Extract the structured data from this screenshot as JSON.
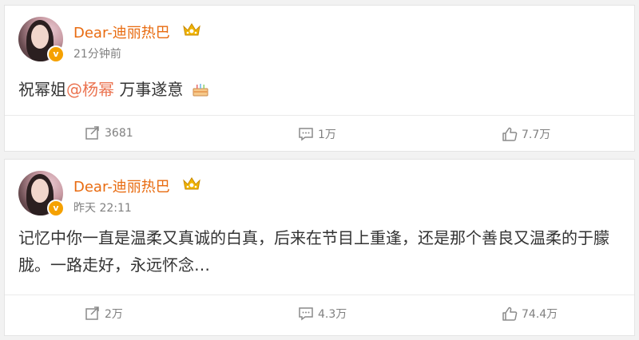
{
  "posts": [
    {
      "user": "Dear-迪丽热巴",
      "time": "21分钟前",
      "text_prefix": "祝幂姐",
      "mention": "@杨幂",
      "text_suffix": " 万事遂意",
      "emoji": "cake-icon",
      "repost_count": "3681",
      "comment_count": "1万",
      "like_count": "7.7万"
    },
    {
      "user": "Dear-迪丽热巴",
      "time": "昨天 22:11",
      "text": "记忆中你一直是温柔又真诚的白真，后来在节目上重逢，还是那个善良又温柔的于朦胧。一路走好，永远怀念…",
      "repost_count": "2万",
      "comment_count": "4.3万",
      "like_count": "74.4万"
    }
  ],
  "colors": {
    "username": "#e86b10",
    "mention": "#eb7350",
    "meta": "#808080",
    "body_text": "#333333",
    "verify_badge": "#f5a100"
  },
  "verify_badge_glyph": "v"
}
